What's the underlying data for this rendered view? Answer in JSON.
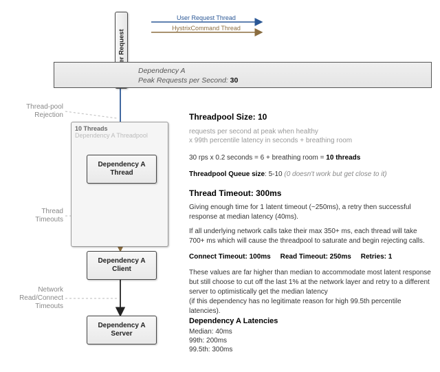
{
  "legend": {
    "user": "User Request Thread",
    "hystrix": "HystrixCommand Thread"
  },
  "colors": {
    "user": "#2a5796",
    "hystrix": "#8b6d3f",
    "dashed": "#bbbbbb"
  },
  "userRequest": "User Request",
  "bar": {
    "line1": "Dependency A",
    "line2_prefix": "Peak Requests per Second:  ",
    "rps": "30"
  },
  "pool": {
    "threads": "10 Threads",
    "name": "Dependency A Threadpool"
  },
  "nodes": {
    "thread": "Dependency A\nThread",
    "client": "Dependency A\nClient",
    "server": "Dependency A\nServer"
  },
  "labels": {
    "rejection": "Thread-pool\nRejection",
    "threadTimeouts": "Thread\nTimeouts",
    "netTimeouts": "Network\nRead/Connect\nTimeouts"
  },
  "rhs": {
    "tp_head": "Threadpool Size: 10",
    "tp_calc1": "requests per second at peak when healthy",
    "tp_calc2": "x 99th percentile latency in seconds + breathing room",
    "tp_eq_prefix": "30 rps x 0.2 seconds = 6 + breathing room = ",
    "tp_eq_bold": "10 threads",
    "q_label": "Threadpool Queue size",
    "q_val": ": 5-10 ",
    "q_note": "(0 doesn't work but get close to it)",
    "tt_head": "Thread Timeout: 300ms",
    "tt_p1": "Giving enough time for 1 latent timeout (~250ms), a retry then successful response at median latency (40ms).",
    "tt_p2": "If all underlying network calls take their max 350+ ms, each thread will take 700+ ms which will cause the threadpool to saturate and begin rejecting calls.",
    "ct": "Connect Timeout: 100ms",
    "rt": "Read Timeout: 250ms",
    "re": "Retries: 1",
    "net_p1": "These values are far higher than median to accommodate most latent response but still choose to cut off the last 1% at the network layer and retry to a different server to optimistically get the median latency",
    "net_p2": "(if this dependency has no legitimate reason for high 99.5th percentile latencies).",
    "lat_head": "Dependency A Latencies",
    "lat_med": "Median: 40ms",
    "lat_99": "99th: 200ms",
    "lat_995": "99.5th: 300ms"
  }
}
